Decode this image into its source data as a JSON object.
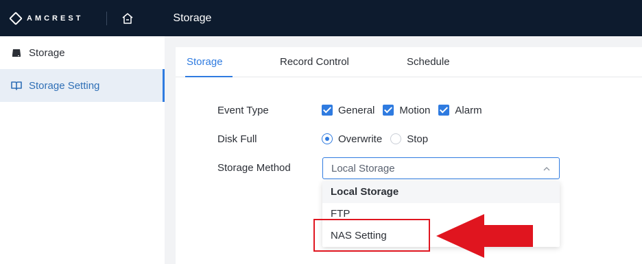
{
  "header": {
    "brand": "AMCREST",
    "title": "Storage",
    "home_icon": "home-icon",
    "bg_color": "#0d1b2e"
  },
  "sidebar": {
    "items": [
      {
        "label": "Storage",
        "icon": "disk-icon",
        "active": false
      },
      {
        "label": "Storage Setting",
        "icon": "book-icon",
        "active": true
      }
    ]
  },
  "tabs": [
    {
      "label": "Storage",
      "active": true
    },
    {
      "label": "Record Control",
      "active": false
    },
    {
      "label": "Schedule",
      "active": false
    }
  ],
  "form": {
    "event_type": {
      "label": "Event Type",
      "options": [
        {
          "label": "General",
          "checked": true
        },
        {
          "label": "Motion",
          "checked": true
        },
        {
          "label": "Alarm",
          "checked": true
        }
      ]
    },
    "disk_full": {
      "label": "Disk Full",
      "options": [
        {
          "label": "Overwrite",
          "selected": true
        },
        {
          "label": "Stop",
          "selected": false
        }
      ]
    },
    "storage_method": {
      "label": "Storage Method",
      "value": "Local Storage",
      "options": [
        "Local Storage",
        "FTP",
        "NAS Setting"
      ]
    }
  },
  "annotation": {
    "highlight_color": "#e0151f",
    "highlighted_option": "NAS Setting"
  },
  "accent_color": "#2f7be0"
}
